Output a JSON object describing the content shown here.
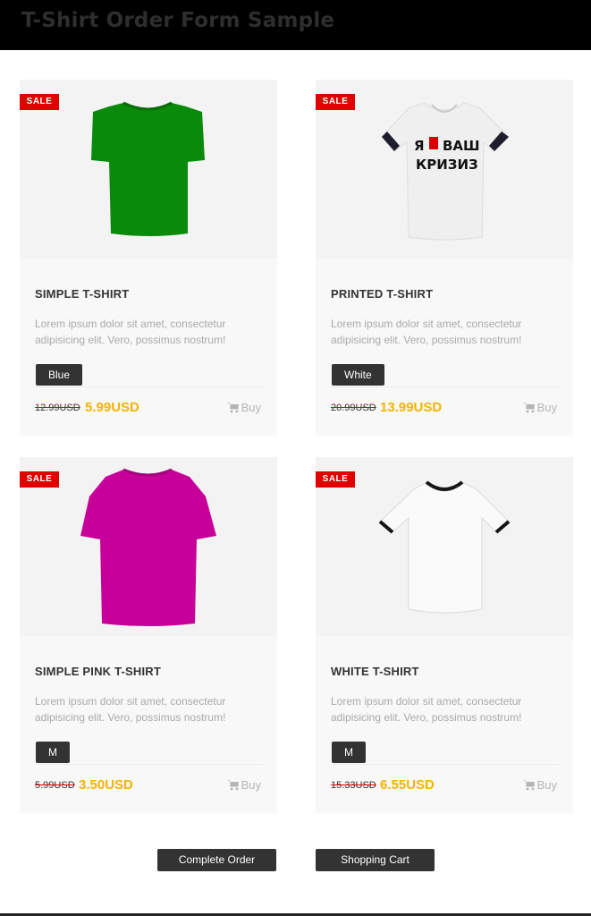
{
  "header": {
    "title": "T-Shirt Order Form Sample"
  },
  "products": [
    {
      "badge": "SALE",
      "title": "SIMPLE T-SHIRT",
      "description": "Lorem ipsum dolor sit amet, consectetur adipisicing elit. Vero, possimus nostrum!",
      "option": "Blue",
      "old_price": "12.99USD",
      "new_price": "5.99USD",
      "buy_label": "Buy",
      "shirt_color": "#0a8a0a"
    },
    {
      "badge": "SALE",
      "title": "PRINTED T-SHIRT",
      "description": "Lorem ipsum dolor sit amet, consectetur adipisicing elit. Vero, possimus nostrum!",
      "option": "White",
      "old_price": "20.99USD",
      "new_price": "13.99USD",
      "buy_label": "Buy",
      "shirt_color": "#efefef",
      "print_line1": "Я",
      "print_line1b": "ВАШ",
      "print_line2": "КРИЗИЗ"
    },
    {
      "badge": "SALE",
      "title": "SIMPLE PINK T-SHIRT",
      "description": "Lorem ipsum dolor sit amet, consectetur adipisicing elit. Vero, possimus nostrum!",
      "option": "M",
      "old_price": "5.99USD",
      "new_price": "3.50USD",
      "buy_label": "Buy",
      "shirt_color": "#c8009a"
    },
    {
      "badge": "SALE",
      "title": "WHITE T-SHIRT",
      "description": "Lorem ipsum dolor sit amet, consectetur adipisicing elit. Vero, possimus nostrum!",
      "option": "M",
      "old_price": "15.33USD",
      "new_price": "6.55USD",
      "buy_label": "Buy",
      "shirt_color": "#fafafa"
    }
  ],
  "actions": {
    "complete_order": "Complete Order",
    "shopping_cart": "Shopping Cart"
  },
  "colors": {
    "sale_badge": "#e00000",
    "new_price": "#f4b400",
    "button_bg": "#333333"
  }
}
